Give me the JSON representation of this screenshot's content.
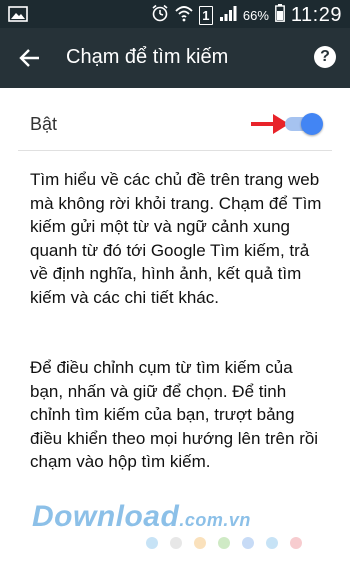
{
  "status_bar": {
    "battery_percent": "66%",
    "time": "11:29",
    "sim_label": "1",
    "icons": [
      "image-icon",
      "alarm-icon",
      "wifi-icon",
      "sim-icon",
      "signal-icon",
      "battery-icon"
    ]
  },
  "toolbar": {
    "title": "Chạm để tìm kiếm",
    "back_icon": "back-arrow-icon",
    "help_icon": "help-icon",
    "help_glyph": "?"
  },
  "setting": {
    "label": "Bật",
    "toggle_on": true,
    "accent_color": "#4285f4",
    "arrow_color": "#e8232a"
  },
  "description": {
    "paragraph1": "Tìm hiểu về các chủ đề trên trang web mà không rời khỏi trang. Chạm để Tìm kiếm gửi một từ và ngữ cảnh xung quanh từ đó tới Google Tìm kiếm, trả về định nghĩa, hình ảnh, kết quả tìm kiếm và các chi tiết khác.",
    "paragraph2": "Để điều chỉnh cụm từ tìm kiếm của bạn, nhấn và giữ để chọn. Để tinh chỉnh tìm kiếm của bạn, trượt bảng điều khiển theo mọi hướng lên trên rồi chạm vào hộp tìm kiếm."
  },
  "watermark": {
    "brand": "Download",
    "domain": ".com.vn",
    "dot_colors": [
      "#8fc7ee",
      "#cfcfcf",
      "#f6c37a",
      "#9fd68c",
      "#8fb7ee",
      "#8fc7ee",
      "#f09aa0"
    ]
  }
}
